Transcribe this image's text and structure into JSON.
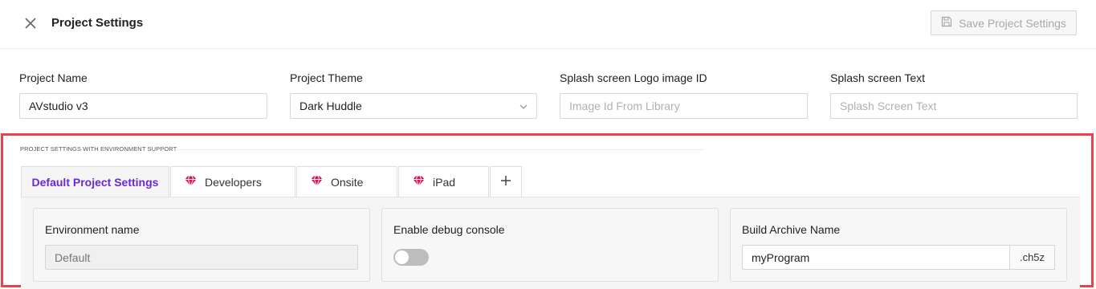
{
  "header": {
    "title": "Project Settings",
    "save_label": "Save Project Settings",
    "close_icon": "close-icon",
    "save_icon": "floppy-disk-icon"
  },
  "fields": {
    "project_name": {
      "label": "Project Name",
      "value": "AVstudio v3"
    },
    "project_theme": {
      "label": "Project Theme",
      "value": "Dark Huddle"
    },
    "splash_logo": {
      "label": "Splash screen Logo image ID",
      "placeholder": "Image Id From Library"
    },
    "splash_text": {
      "label": "Splash screen Text",
      "placeholder": "Splash Screen Text"
    }
  },
  "environment": {
    "heading": "PROJECT SETTINGS WITH ENVIRONMENT SUPPORT",
    "tabs": [
      {
        "label": "Default Project Settings",
        "active": true
      },
      {
        "label": "Developers",
        "icon": "gem-icon"
      },
      {
        "label": "Onsite",
        "icon": "gem-icon"
      },
      {
        "label": "iPad",
        "icon": "gem-icon"
      }
    ],
    "add_tab_label": "+",
    "cards": {
      "env_name": {
        "label": "Environment name",
        "placeholder": "Default"
      },
      "debug": {
        "label": "Enable debug console",
        "enabled": false
      },
      "archive": {
        "label": "Build Archive Name",
        "value": "myProgram",
        "suffix": ".ch5z"
      }
    }
  },
  "colors": {
    "accent": "#6a28d6",
    "gem": "#d6155a",
    "highlight_border": "#e8434c"
  }
}
